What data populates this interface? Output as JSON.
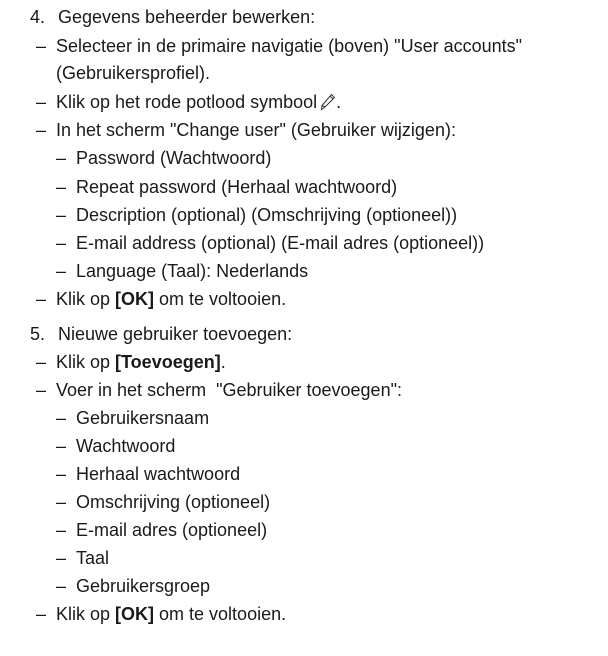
{
  "sections": [
    {
      "number": "4.",
      "title": "Gegevens beheerder bewerken:",
      "items": [
        {
          "level": 1,
          "line1": "Selecteer in de primaire navigatie (boven) \"User accounts\"",
          "line2": "(Gebruikersprofiel)."
        },
        {
          "level": 1,
          "text": "Klik op het rode potlood symbool",
          "icon": "pencil-icon",
          "after": "."
        },
        {
          "level": 1,
          "text": "In het scherm \"Change user\" (Gebruiker wijzigen):"
        },
        {
          "level": 2,
          "text": "Password (Wachtwoord)"
        },
        {
          "level": 2,
          "text": "Repeat password (Herhaal wachtwoord)"
        },
        {
          "level": 2,
          "text": "Description (optional) (Omschrijving (optioneel))"
        },
        {
          "level": 2,
          "text": "E-mail address (optional) (E-mail adres (optioneel))"
        },
        {
          "level": 2,
          "text": "Language (Taal): Nederlands"
        },
        {
          "level": 1,
          "pre": "Klik op ",
          "bold": "[OK]",
          "post": " om te voltooien."
        }
      ]
    },
    {
      "number": "5.",
      "title": "Nieuwe gebruiker toevoegen:",
      "items": [
        {
          "level": 1,
          "pre": "Klik op ",
          "bold": "[Toevoegen]",
          "post": "."
        },
        {
          "level": 1,
          "text": "Voer in het scherm  \"Gebruiker toevoegen\":"
        },
        {
          "level": 2,
          "text": "Gebruikersnaam"
        },
        {
          "level": 2,
          "text": "Wachtwoord"
        },
        {
          "level": 2,
          "text": "Herhaal wachtwoord"
        },
        {
          "level": 2,
          "text": "Omschrijving (optioneel)"
        },
        {
          "level": 2,
          "text": "E-mail adres (optioneel)"
        },
        {
          "level": 2,
          "text": "Taal"
        },
        {
          "level": 2,
          "text": "Gebruikersgroep"
        },
        {
          "level": 1,
          "pre": "Klik op ",
          "bold": "[OK]",
          "post": " om te voltooien."
        }
      ]
    }
  ],
  "dash_char": "–"
}
